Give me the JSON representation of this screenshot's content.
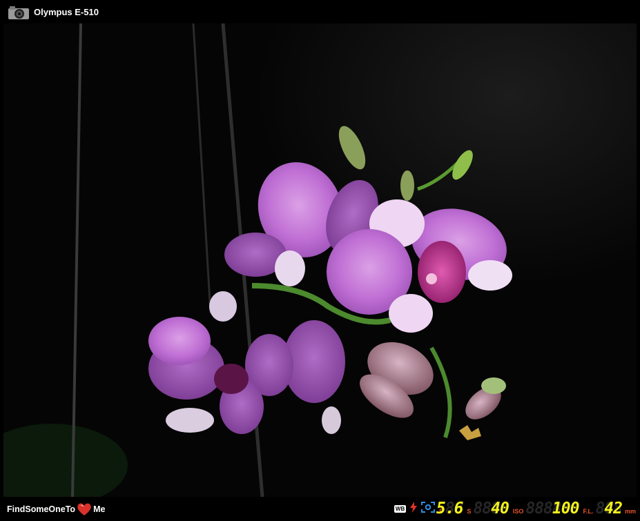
{
  "header": {
    "camera_icon": "camera-icon",
    "title": "Olympus E-510"
  },
  "photo": {
    "subject": "purple orchid flowers on dark background"
  },
  "footer": {
    "brand_left": "FindSomeOneTo",
    "brand_heart_icon": "heart-icon",
    "brand_right": "Me",
    "exif": {
      "wb_label": "WB",
      "flash_icon": "flash-icon",
      "metering_icon": "metering-icon",
      "aperture_label": "F",
      "aperture_ghost": "88",
      "aperture_value": "5.6",
      "shutter_label": "S",
      "shutter_ghost": "8888",
      "shutter_value": "40",
      "iso_label": "ISO",
      "iso_ghost": "888888",
      "iso_value": "100",
      "focal_label": "F.L.",
      "focal_ghost": "888",
      "focal_value": "42",
      "focal_unit": "mm"
    }
  }
}
